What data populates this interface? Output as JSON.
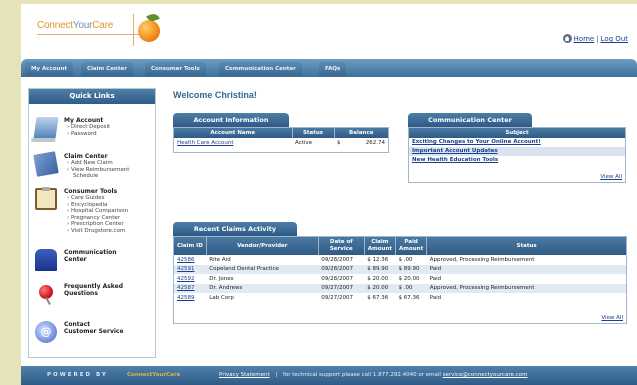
{
  "header": {
    "logo_part1": "Connect",
    "logo_part2": "Your",
    "logo_part3": "Care",
    "home_label": "Home",
    "logout_label": "Log Out",
    "separator": "|"
  },
  "nav": {
    "tabs": [
      "My Account",
      "Claim Center",
      "Consumer Tools",
      "Communication Center",
      "FAQs"
    ]
  },
  "sidebar": {
    "title": "Quick Links",
    "sections": [
      {
        "title": "My Account",
        "items": [
          "Direct Deposit",
          "Password"
        ],
        "icon": "laptop-icon"
      },
      {
        "title": "Claim Center",
        "items": [
          "Add New Claim",
          "View Reimbursement",
          "Schedule"
        ],
        "icon": "document-icon"
      },
      {
        "title": "Consumer Tools",
        "items": [
          "Care Guides",
          "Encyclopedia",
          "Hospital Comparison",
          "Pregnancy Center",
          "Prescription Center",
          "Visit Drugstore.com"
        ],
        "icon": "clipboard-icon"
      },
      {
        "title": "Communication Center",
        "items": [],
        "icon": "mailbox-icon"
      },
      {
        "title": "Frequently Asked Questions",
        "items": [],
        "icon": "pushpin-icon"
      },
      {
        "title": "Contact Customer Service",
        "items": [],
        "icon": "email-at-icon"
      }
    ]
  },
  "welcome": "Welcome Christina!",
  "account_info": {
    "title": "Account Information",
    "columns": [
      "Account Name",
      "Status",
      "Balance"
    ],
    "rows": [
      {
        "name": "Health Care Account",
        "status": "Active",
        "currency": "$",
        "balance": "262.74"
      }
    ]
  },
  "communication": {
    "title": "Communication Center",
    "column": "Subject",
    "rows": [
      "Exciting Changes to Your Online Account!",
      "Important Account Updates",
      "New Health Education Tools"
    ],
    "view_all": "View All"
  },
  "claims": {
    "title": "Recent Claims Activity",
    "columns": [
      "Claim ID",
      "Vendor/Provider",
      "Date of Service",
      "Claim Amount",
      "Paid Amount",
      "Status"
    ],
    "rows": [
      {
        "id": "42586",
        "vendor": "Rite Aid",
        "date": "09/28/2007",
        "claim": "$ 12.36",
        "paid": "$ .00",
        "status": "Approved, Processing Reimbursement"
      },
      {
        "id": "42591",
        "vendor": "Copeland Dental Practice",
        "date": "09/28/2007",
        "claim": "$ 89.90",
        "paid": "$ 89.90",
        "status": "Paid"
      },
      {
        "id": "42592",
        "vendor": "Dr. Jones",
        "date": "09/28/2007",
        "claim": "$ 20.00",
        "paid": "$ 20.00",
        "status": "Paid"
      },
      {
        "id": "42587",
        "vendor": "Dr. Andrews",
        "date": "09/27/2007",
        "claim": "$ 20.00",
        "paid": "$ .00",
        "status": "Approved, Processing Reimbursement"
      },
      {
        "id": "42589",
        "vendor": "Lab Corp",
        "date": "09/27/2007",
        "claim": "$ 67.36",
        "paid": "$ 67.36",
        "status": "Paid"
      }
    ],
    "view_all": "View All"
  },
  "footer": {
    "powered_by": "POWERED BY",
    "brand": "ConnectYourCare",
    "privacy": "Privacy Statement",
    "separator": "|",
    "support_text": "for technical support please call 1.877.292.4040 or email",
    "email": "service@connectyourcare.com"
  }
}
